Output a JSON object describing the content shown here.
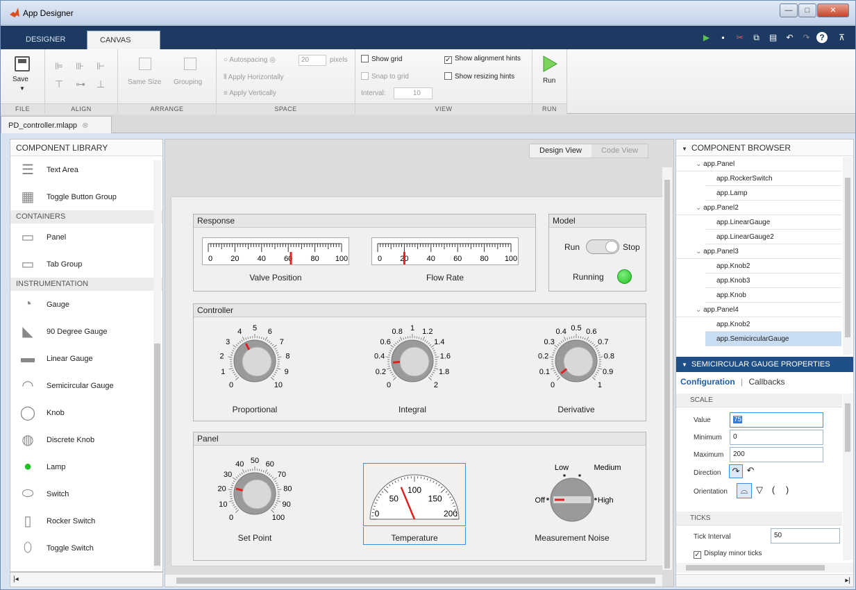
{
  "window": {
    "title": "App Designer",
    "minimize": "—",
    "maximize": "□",
    "close": "✕"
  },
  "tabs": [
    "DESIGNER",
    "CANVAS"
  ],
  "ribbon": {
    "file": {
      "save": "Save",
      "label": "FILE"
    },
    "align": {
      "label": "ALIGN"
    },
    "arrange": {
      "same_size": "Same Size",
      "grouping": "Grouping",
      "label": "ARRANGE"
    },
    "space": {
      "autospacing": "Autospacing",
      "value": "20",
      "units": "pixels",
      "apply_h": "Apply Horizontally",
      "apply_v": "Apply Vertically",
      "label": "SPACE"
    },
    "view": {
      "show_grid": "Show grid",
      "snap": "Snap to grid",
      "interval_label": "Interval:",
      "interval": "10",
      "align_hints": "Show alignment hints",
      "resize_hints": "Show resizing hints",
      "label": "VIEW"
    },
    "run": {
      "run": "Run",
      "label": "RUN"
    }
  },
  "file_tab": "PD_controller.mlapp",
  "library": {
    "title": "COMPONENT LIBRARY",
    "items_top": [
      "Text Area",
      "Toggle Button Group"
    ],
    "containers_label": "CONTAINERS",
    "containers": [
      "Panel",
      "Tab Group"
    ],
    "instr_label": "INSTRUMENTATION",
    "instruments": [
      "Gauge",
      "90 Degree Gauge",
      "Linear Gauge",
      "Semicircular Gauge",
      "Knob",
      "Discrete Knob",
      "Lamp",
      "Switch",
      "Rocker Switch",
      "Toggle Switch"
    ],
    "icon_title": "Title"
  },
  "views": {
    "design": "Design View",
    "code": "Code View"
  },
  "canvas": {
    "response": {
      "title": "Response",
      "valve": {
        "label": "Valve Position",
        "ticks": [
          "0",
          "20",
          "40",
          "60",
          "80",
          "100"
        ],
        "value": 62
      },
      "flow": {
        "label": "Flow Rate",
        "ticks": [
          "0",
          "20",
          "40",
          "60",
          "80",
          "100"
        ],
        "value": 20
      }
    },
    "model": {
      "title": "Model",
      "run": "Run",
      "stop": "Stop",
      "running": "Running"
    },
    "controller": {
      "title": "Controller",
      "proportional": {
        "label": "Proportional",
        "ticks": [
          "0",
          "1",
          "2",
          "3",
          "4",
          "5",
          "6",
          "7",
          "8",
          "9",
          "10"
        ]
      },
      "integral": {
        "label": "Integral",
        "ticks": [
          "0",
          "0.2",
          "0.4",
          "0.6",
          "0.8",
          "1",
          "1.2",
          "1.4",
          "1.6",
          "1.8",
          "2"
        ]
      },
      "derivative": {
        "label": "Derivative",
        "ticks": [
          "0",
          "0.1",
          "0.2",
          "0.3",
          "0.4",
          "0.5",
          "0.6",
          "0.7",
          "0.8",
          "0.9",
          "1"
        ]
      }
    },
    "panel": {
      "title": "Panel",
      "setpoint": {
        "label": "Set Point",
        "ticks": [
          "0",
          "10",
          "20",
          "30",
          "40",
          "50",
          "60",
          "70",
          "80",
          "90",
          "100"
        ]
      },
      "temperature": {
        "label": "Temperature",
        "ticks": [
          "0",
          "50",
          "100",
          "150",
          "200"
        ],
        "value": 75
      },
      "noise": {
        "label": "Measurement Noise",
        "off": "Off",
        "low": "Low",
        "medium": "Medium",
        "high": "High"
      }
    }
  },
  "browser": {
    "title": "COMPONENT BROWSER",
    "nodes": [
      {
        "text": "app.Panel",
        "level": 1
      },
      {
        "text": "app.RockerSwitch",
        "level": 2
      },
      {
        "text": "app.Lamp",
        "level": 2
      },
      {
        "text": "app.Panel2",
        "level": 1
      },
      {
        "text": "app.LinearGauge",
        "level": 2
      },
      {
        "text": "app.LinearGauge2",
        "level": 2
      },
      {
        "text": "app.Panel3",
        "level": 1
      },
      {
        "text": "app.Knob2",
        "level": 2
      },
      {
        "text": "app.Knob3",
        "level": 2
      },
      {
        "text": "app.Knob",
        "level": 2
      },
      {
        "text": "app.Panel4",
        "level": 1
      },
      {
        "text": "app.Knob2",
        "level": 2
      },
      {
        "text": "app.SemicircularGauge",
        "level": 2,
        "selected": true
      }
    ]
  },
  "props": {
    "title": "SEMICIRCULAR GAUGE PROPERTIES",
    "tab_config": "Configuration",
    "separator": "|",
    "tab_callbacks": "Callbacks",
    "scale": "SCALE",
    "value_label": "Value",
    "value": "75",
    "min_label": "Minimum",
    "min": "0",
    "max_label": "Maximum",
    "max": "200",
    "direction": "Direction",
    "orientation": "Orientation",
    "ticks": "TICKS",
    "tick_interval_label": "Tick Interval",
    "tick_interval": "50",
    "minor": "Display minor ticks"
  },
  "colors": {
    "accent": "#1e4f88",
    "tabbar": "#1d3b62",
    "lamp": "#22c022",
    "needle": "#e02020"
  }
}
